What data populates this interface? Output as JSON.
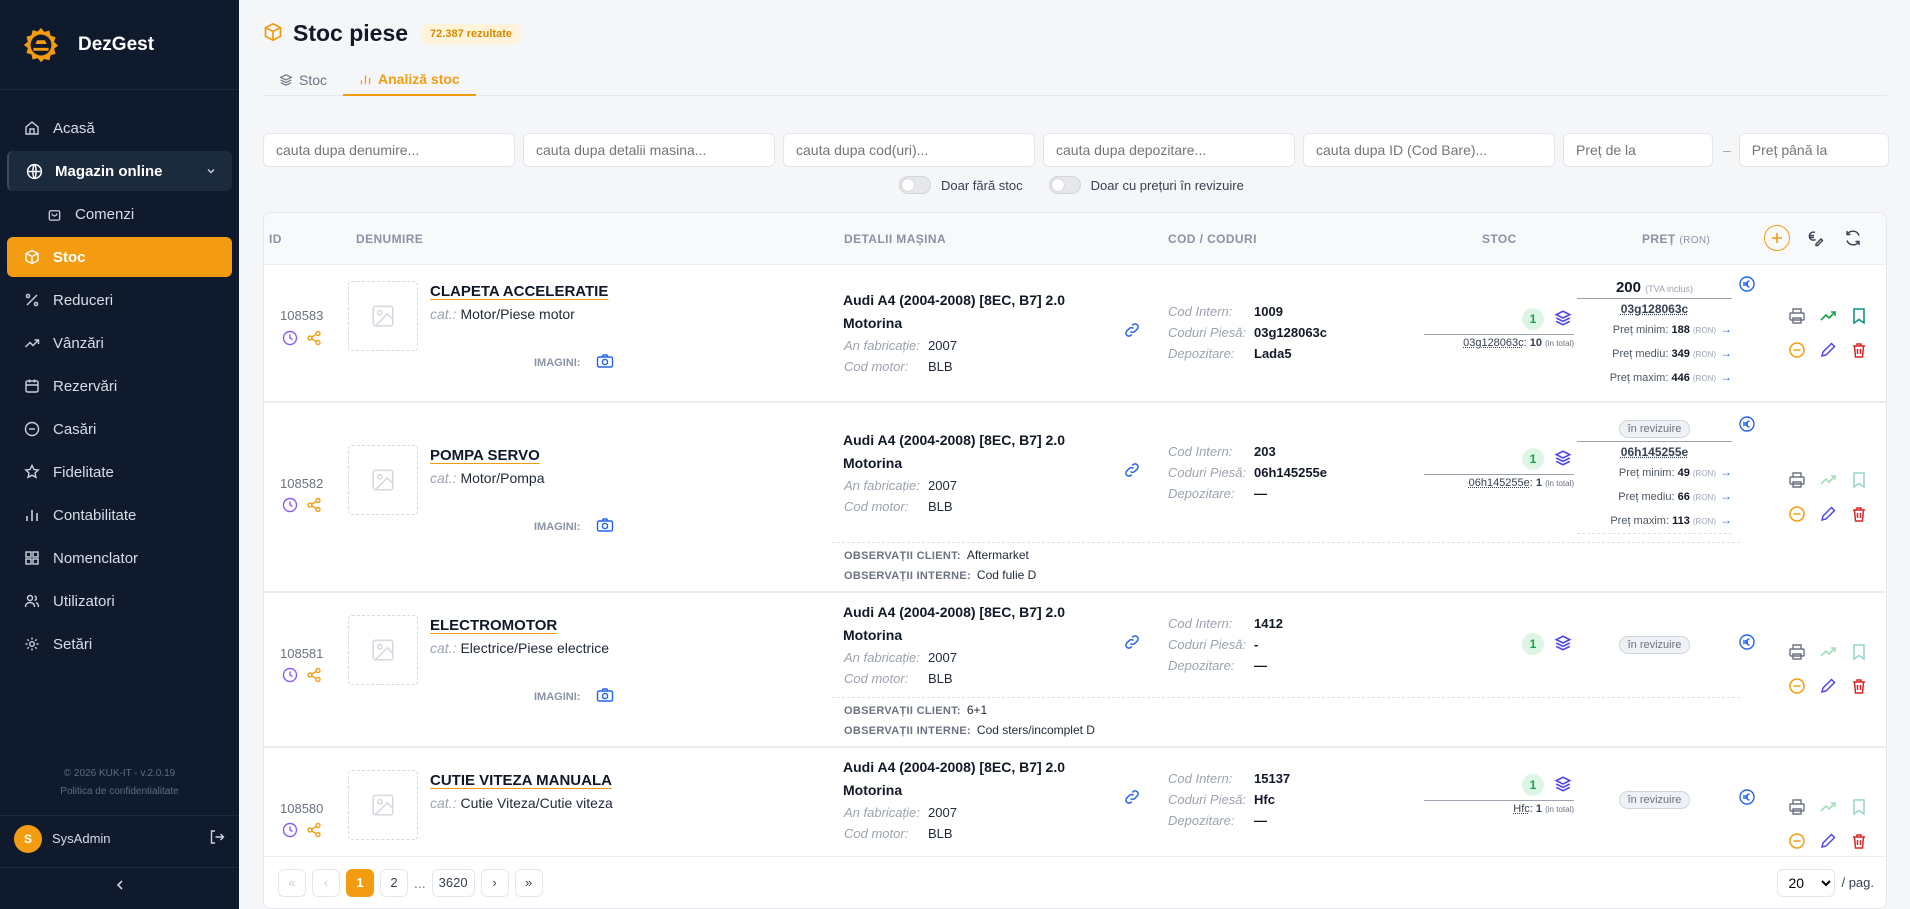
{
  "app": {
    "name": "DezGest"
  },
  "sidebar": {
    "items": [
      {
        "label": "Acasă",
        "icon": "home-icon"
      },
      {
        "label": "Magazin online",
        "icon": "globe-icon"
      },
      {
        "label": "Comenzi",
        "icon": "bag-icon"
      },
      {
        "label": "Stoc",
        "icon": "box-icon"
      },
      {
        "label": "Reduceri",
        "icon": "percent-icon"
      },
      {
        "label": "Vânzări",
        "icon": "trend-icon"
      },
      {
        "label": "Rezervări",
        "icon": "calendar-icon"
      },
      {
        "label": "Casări",
        "icon": "minus-circle-icon"
      },
      {
        "label": "Fidelitate",
        "icon": "star-icon"
      },
      {
        "label": "Contabilitate",
        "icon": "chart-icon"
      },
      {
        "label": "Nomenclator",
        "icon": "grid-icon"
      },
      {
        "label": "Utilizatori",
        "icon": "users-icon"
      },
      {
        "label": "Setări",
        "icon": "gear-icon"
      }
    ],
    "footer_version": "© 2026 KUK-IT - v.2.0.19",
    "footer_policy": "Politica de confidentialitate",
    "user": {
      "initial": "S",
      "name": "SysAdmin"
    }
  },
  "page": {
    "title": "Stoc piese",
    "count": "72.387 rezultate",
    "tabs": [
      "Stoc",
      "Analiză stoc"
    ]
  },
  "filters": {
    "name": "cauta dupa denumire...",
    "car": "cauta dupa detalii masina...",
    "codes": "cauta dupa cod(uri)...",
    "storage": "cauta dupa depozitare...",
    "barcode": "cauta dupa ID (Cod Bare)...",
    "price_from": "Preț de la",
    "price_to": "Preț până la",
    "dash": "–",
    "toggle_no_stock": "Doar fără stoc",
    "toggle_review": "Doar cu prețuri în revizuire"
  },
  "table": {
    "headers": {
      "id": "ID",
      "name": "DENUMIRE",
      "car": "DETALII MAȘINA",
      "codes": "COD / CODURI",
      "stock": "STOC",
      "price": "PREȚ",
      "price_unit": "(RON)"
    },
    "labels": {
      "cat": "cat.:",
      "images": "IMAGINI:",
      "year": "An fabricație:",
      "engine": "Cod motor:",
      "internal": "Cod Intern:",
      "part_codes": "Coduri Piesă:",
      "storage": "Depozitare:",
      "obs_client": "OBSERVAȚII CLIENT:",
      "obs_internal": "OBSERVAȚII INTERNE:",
      "total": "(in total)",
      "tva": "(TVA inclus)",
      "min": "Preț minim:",
      "avg": "Preț mediu:",
      "max": "Preț maxim:",
      "ron": "(RON)",
      "review": "în revizuire"
    },
    "rows": [
      {
        "id": "108583",
        "name": "CLAPETA ACCELERATIE",
        "category": "Motor/Piese motor",
        "car": "Audi A4 (2004-2008) [8EC, B7] 2.0",
        "fuel": "Motorina",
        "year": "2007",
        "engine": "BLB",
        "internal": "1009",
        "part_codes": "03g128063c",
        "storage": "Lada5",
        "qty": "1",
        "stock_code": "03g128063c",
        "stock_total": "10",
        "price": "200",
        "price_code": "03g128063c",
        "min": "188",
        "avg": "349",
        "max": "446"
      },
      {
        "id": "108582",
        "name": "POMPA SERVO",
        "category": "Motor/Pompa",
        "car": "Audi A4 (2004-2008) [8EC, B7] 2.0",
        "fuel": "Motorina",
        "year": "2007",
        "engine": "BLB",
        "internal": "203",
        "part_codes": "06h145255e",
        "storage": "—",
        "qty": "1",
        "stock_code": "06h145255e",
        "stock_total": "1",
        "price_code": "06h145255e",
        "min": "49",
        "avg": "66",
        "max": "113",
        "obs_client": "Aftermarket",
        "obs_internal": "Cod fulie D"
      },
      {
        "id": "108581",
        "name": "ELECTROMOTOR",
        "category": "Electrice/Piese electrice",
        "car": "Audi A4 (2004-2008) [8EC, B7] 2.0",
        "fuel": "Motorina",
        "year": "2007",
        "engine": "BLB",
        "internal": "1412",
        "part_codes": "-",
        "storage": "—",
        "qty": "1",
        "obs_client": "6+1",
        "obs_internal": "Cod sters/incomplet D"
      },
      {
        "id": "108580",
        "name": "CUTIE VITEZA MANUALA",
        "category": "Cutie Viteza/Cutie viteza",
        "car": "Audi A4 (2004-2008) [8EC, B7] 2.0",
        "fuel": "Motorina",
        "year": "2007",
        "engine": "BLB",
        "internal": "15137",
        "part_codes": "Hfc",
        "storage": "—",
        "qty": "1",
        "stock_code": "Hfc",
        "stock_total": "1"
      }
    ]
  },
  "pagination": {
    "first": "«",
    "prev": "‹",
    "pages": [
      "1",
      "2"
    ],
    "dots": "...",
    "last_page": "3620",
    "next": "›",
    "last": "»",
    "per_page": "20",
    "per_label": "/ pag."
  },
  "colors": {
    "accent": "#f39c12",
    "sidebar": "#0f1b2d",
    "link": "#2563eb",
    "danger": "#dc2626",
    "success": "#16a34a",
    "ok_green": "#16a34a"
  }
}
